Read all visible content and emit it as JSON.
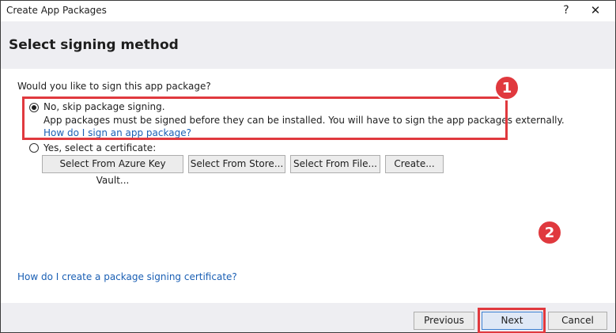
{
  "window": {
    "title": "Create App Packages",
    "help_glyph": "?",
    "close_glyph": "✕"
  },
  "header": {
    "title": "Select signing method"
  },
  "content": {
    "question": "Would you like to sign this app package?",
    "option_skip": {
      "label": "No, skip package signing.",
      "description": "App packages must be signed before they can be installed. You will have to sign the app packages externally.",
      "link": "How do I sign an app package?",
      "selected": true
    },
    "option_certificate": {
      "label": "Yes, select a certificate:",
      "selected": false
    },
    "buttons": {
      "azure": "Select From Azure Key Vault...",
      "store": "Select From Store...",
      "file": "Select From File...",
      "create": "Create..."
    },
    "bottom_link": "How do I create a package signing certificate?"
  },
  "footer": {
    "previous": "Previous",
    "next": "Next",
    "cancel": "Cancel"
  },
  "annotations": {
    "badge_1": "1",
    "badge_2": "2",
    "highlight_color": "#e0393e"
  }
}
